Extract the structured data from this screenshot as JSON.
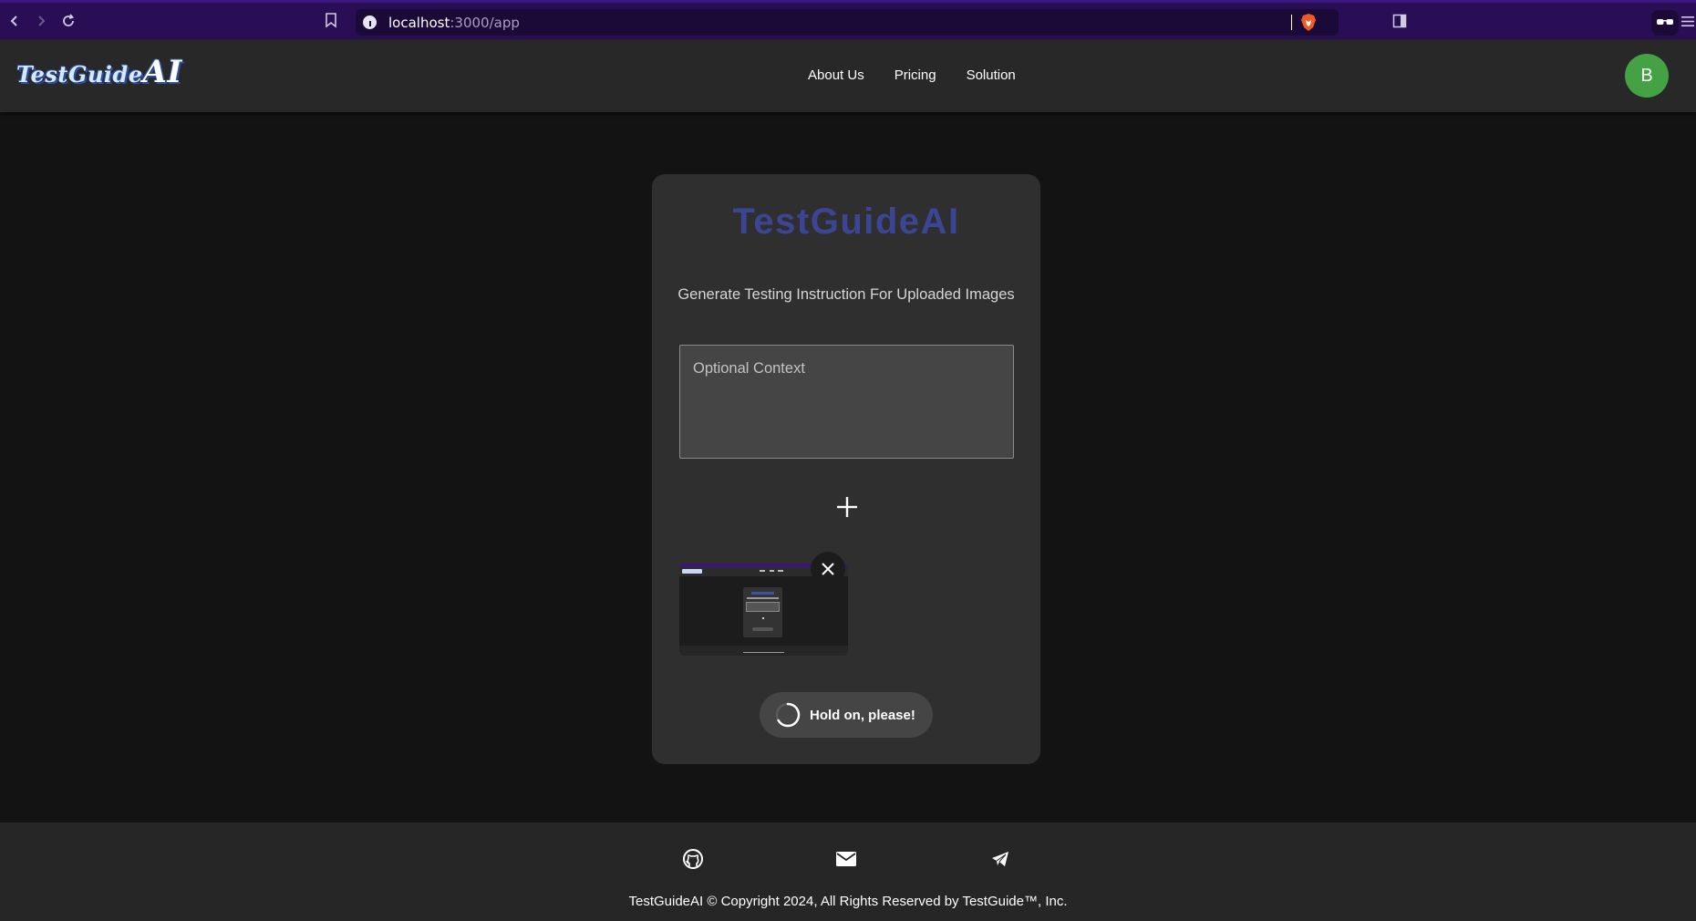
{
  "browser": {
    "url_host": "localhost",
    "url_path": ":3000/app"
  },
  "header": {
    "logo_small": "TestGuide",
    "logo_big": "AI",
    "nav": [
      "About Us",
      "Pricing",
      "Solution"
    ],
    "avatar_initial": "B"
  },
  "main": {
    "title": "TestGuideAI",
    "subtitle": "Generate Testing Instruction For Uploaded Images",
    "context_placeholder": "Optional Context",
    "loading_label": "Hold on, please!"
  },
  "footer": {
    "icons": [
      "github-icon",
      "mail-icon",
      "telegram-icon"
    ],
    "copyright": "TestGuideAI © Copyright 2024, All Rights Reserved by TestGuide™, Inc."
  },
  "colors": {
    "title": "#3b4594",
    "avatar": "#44a244",
    "browser_bar": "#2a0e55"
  }
}
